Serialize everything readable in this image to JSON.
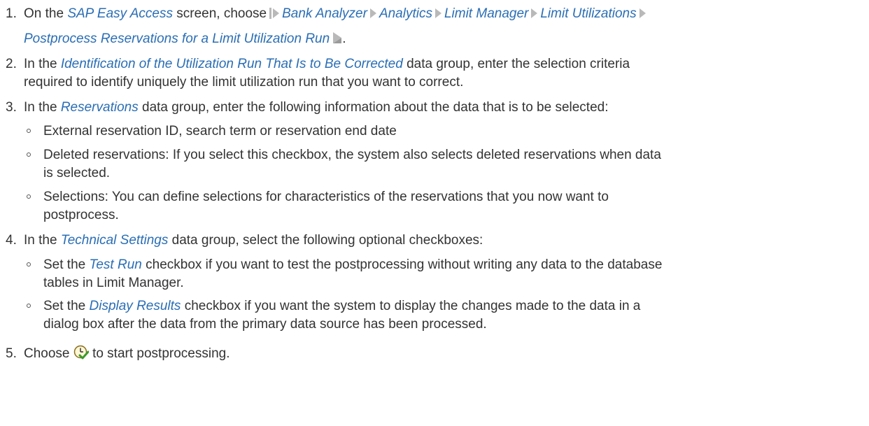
{
  "steps": [
    {
      "number": "1.",
      "intro": "On the",
      "screen_name": "SAP Easy Access",
      "after": "screen, choose",
      "path": [
        "Bank Analyzer",
        "Analytics",
        "Limit Manager",
        "Limit Utilizations",
        "Postprocess Reservations for a Limit Utilization Run"
      ],
      "end": "."
    },
    {
      "number": "2.",
      "intro": "In the",
      "group": "Identification of the Utilization Run That Is to Be Corrected",
      "text1": "data group, enter the selection criteria",
      "text2": "required to identify uniquely the limit utilization run that you want to correct."
    },
    {
      "number": "3.",
      "intro": "In the",
      "group": "Reservations",
      "text": "data group, enter the following information about the data that is to be selected:",
      "bullets": [
        {
          "l1": "External reservation ID, search term or reservation end date"
        },
        {
          "l1": "Deleted reservations: If you select this checkbox, the system also selects deleted reservations when data",
          "l2": "is selected."
        },
        {
          "l1": "Selections: You can define selections for characteristics of the reservations that you now want to",
          "l2": "postprocess."
        }
      ]
    },
    {
      "number": "4.",
      "intro": "In the",
      "group": "Technical Settings",
      "text": "data group, select the following optional checkboxes:",
      "bullets": [
        {
          "pre": "Set the",
          "term": "Test Run",
          "post": "checkbox if you want to test the postprocessing without writing any data to the database",
          "l2": "tables in Limit Manager."
        },
        {
          "pre": "Set the",
          "term": "Display Results",
          "post": "checkbox if you want the system to display the changes made to the data in a",
          "l2": "dialog box after the data from the primary data source has been processed."
        }
      ]
    },
    {
      "number": "5.",
      "intro": "Choose",
      "icon": "execute-clock-icon",
      "text": "to start postprocessing."
    }
  ]
}
